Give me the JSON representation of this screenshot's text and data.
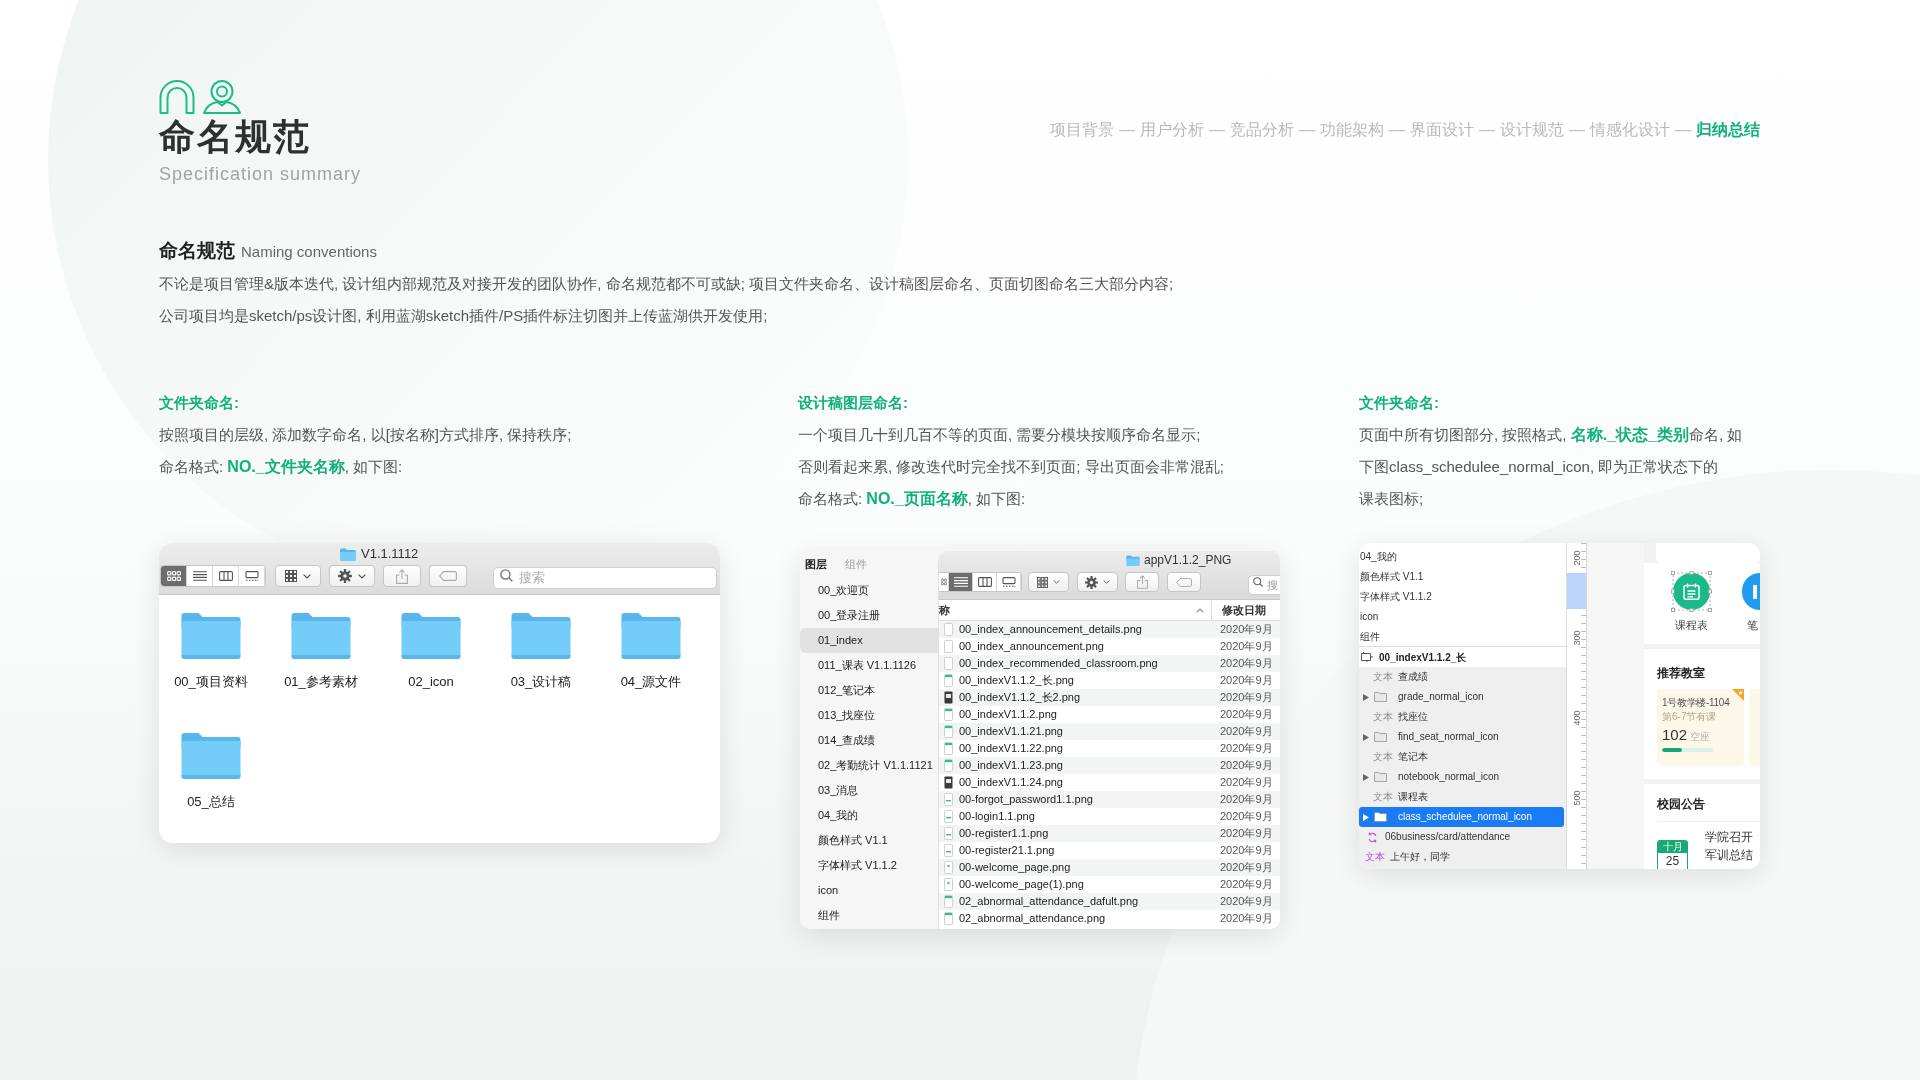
{
  "header": {
    "title": "命名规范",
    "subtitle": "Specification summary"
  },
  "nav": {
    "separator": "—",
    "items": [
      {
        "label": "项目背景",
        "selected": false
      },
      {
        "label": "用户分析",
        "selected": false
      },
      {
        "label": "竞品分析",
        "selected": false
      },
      {
        "label": "功能架构",
        "selected": false
      },
      {
        "label": "界面设计",
        "selected": false
      },
      {
        "label": "设计规范",
        "selected": false
      },
      {
        "label": "情感化设计",
        "selected": false
      },
      {
        "label": "归纳总结",
        "selected": true
      }
    ]
  },
  "intro": {
    "title": "命名规范",
    "title_en": "Naming conventions",
    "lines": [
      "不论是项目管理&版本迭代, 设计组内部规范及对接开发的团队协作, 命名规范都不可或缺; 项目文件夹命名、设计稿图层命名、页面切图命名三大部分内容;",
      "公司项目均是sketch/ps设计图, 利用蓝湖sketch插件/PS插件标注切图并上传蓝湖供开发使用;"
    ]
  },
  "columns": [
    {
      "heading": "文件夹命名:",
      "lines": [
        "按照项目的层级, 添加数字命名, 以[按名称]方式排序, 保持秩序;",
        "命名格式: **NO._文件夹名称**, 如下图:"
      ],
      "figure": {
        "kind": "folder_window",
        "title": "V1.1.1112",
        "view_modes": [
          {
            "kind": "grid",
            "selected": true
          },
          {
            "kind": "list",
            "selected": false
          },
          {
            "kind": "columns",
            "selected": false
          },
          {
            "kind": "gallery",
            "selected": false
          }
        ],
        "search": {
          "placeholder": "搜索"
        },
        "folders": [
          "00_项目资料",
          "01_参考素材",
          "02_icon",
          "03_设计稿",
          "04_源文件",
          "05_总结"
        ]
      }
    },
    {
      "heading": "设计稿图层命名:",
      "lines": [
        "一个项目几十到几百不等的页面, 需要分模块按顺序命名显示;",
        "否则看起来累, 修改迭代时完全找不到页面; 导出页面会非常混乱;",
        "命名格式: **NO._页面名称**, 如下图:"
      ],
      "figure": {
        "kind": "sketch_export",
        "tabs": [
          {
            "label": "图层",
            "selected": true
          },
          {
            "label": "组件",
            "selected": false
          }
        ],
        "pages": [
          {
            "label": "00_欢迎页",
            "selected": false
          },
          {
            "label": "00_登录注册",
            "selected": false
          },
          {
            "label": "01_index",
            "selected": true
          },
          {
            "label": "011_课表 V1.1.1126",
            "selected": false
          },
          {
            "label": "012_笔记本",
            "selected": false
          },
          {
            "label": "013_找座位",
            "selected": false
          },
          {
            "label": "014_查成绩",
            "selected": false
          },
          {
            "label": "02_考勤统计 V1.1.1121",
            "selected": false
          },
          {
            "label": "03_消息",
            "selected": false
          },
          {
            "label": "04_我的",
            "selected": false
          },
          {
            "label": "颜色样式 V1.1",
            "selected": false
          },
          {
            "label": "字体样式 V1.1.2",
            "selected": false
          },
          {
            "label": "icon",
            "selected": false
          },
          {
            "label": "组件",
            "selected": false
          }
        ],
        "window": {
          "title": "appV1.1.2_PNG",
          "view_modes": [
            {
              "kind": "grid",
              "selected": false
            },
            {
              "kind": "list",
              "selected": true
            },
            {
              "kind": "columns",
              "selected": false
            },
            {
              "kind": "gallery",
              "selected": false
            }
          ],
          "search": {
            "placeholder": "搜"
          },
          "columns": [
            "称",
            "修改日期"
          ],
          "files": [
            {
              "name": "00_index_announcement_details.png",
              "date": "2020年9月",
              "kind": "plain"
            },
            {
              "name": "00_index_announcement.png",
              "date": "2020年9月",
              "kind": "plain"
            },
            {
              "name": "00_index_recommended_classroom.png",
              "date": "2020年9月",
              "kind": "plain"
            },
            {
              "name": "00_indexV1.1.2_长.png",
              "date": "2020年9月",
              "kind": "green"
            },
            {
              "name": "00_indexV1.1.2_长2.png",
              "date": "2020年9月",
              "kind": "dark"
            },
            {
              "name": "00_indexV1.1.2.png",
              "date": "2020年9月",
              "kind": "green"
            },
            {
              "name": "00_indexV1.1.21.png",
              "date": "2020年9月",
              "kind": "green"
            },
            {
              "name": "00_indexV1.1.22.png",
              "date": "2020年9月",
              "kind": "green"
            },
            {
              "name": "00_indexV1.1.23.png",
              "date": "2020年9月",
              "kind": "green"
            },
            {
              "name": "00_indexV1.1.24.png",
              "date": "2020年9月",
              "kind": "dark"
            },
            {
              "name": "00-forgot_password1.1.png",
              "date": "2020年9月",
              "kind": "form"
            },
            {
              "name": "00-login1.1.png",
              "date": "2020年9月",
              "kind": "form"
            },
            {
              "name": "00-register1.1.png",
              "date": "2020年9月",
              "kind": "form"
            },
            {
              "name": "00-register21.1.png",
              "date": "2020年9月",
              "kind": "form"
            },
            {
              "name": "00-welcome_page.png",
              "date": "2020年9月",
              "kind": "welcome"
            },
            {
              "name": "00-welcome_page(1).png",
              "date": "2020年9月",
              "kind": "welcome"
            },
            {
              "name": "02_abnormal_attendance_dafult.png",
              "date": "2020年9月",
              "kind": "green"
            },
            {
              "name": "02_abnormal_attendance.png",
              "date": "2020年9月",
              "kind": "green"
            }
          ]
        }
      }
    },
    {
      "heading": "文件夹命名:",
      "lines": [
        "页面中所有切图部分, 按照格式, **名称._状态_类别**命名, 如",
        "下图class_schedulee_normal_icon, 即为正常状态下的",
        "课表图标;"
      ],
      "figure": {
        "kind": "sketch_layers",
        "pages": [
          {
            "label": "04_我的",
            "selected": false
          },
          {
            "label": "颜色样式 V1.1",
            "selected": false
          },
          {
            "label": "字体样式 V1.1.2",
            "selected": false
          },
          {
            "label": "icon",
            "selected": false
          },
          {
            "label": "组件",
            "selected": false
          }
        ],
        "artboard": {
          "label": "00_indexV1.1.2_长",
          "children": [
            {
              "kind": "text",
              "tag": "文本",
              "label": "查成绩",
              "selected": false
            },
            {
              "kind": "group",
              "label": "grade_normal_icon",
              "expanded": false,
              "selected": false
            },
            {
              "kind": "text",
              "tag": "文本",
              "label": "找座位",
              "selected": false
            },
            {
              "kind": "group",
              "label": "find_seat_normal_icon",
              "expanded": false,
              "selected": false
            },
            {
              "kind": "text",
              "tag": "文本",
              "label": "笔记本",
              "selected": false
            },
            {
              "kind": "group",
              "label": "notebook_normal_icon",
              "expanded": false,
              "selected": false
            },
            {
              "kind": "text",
              "tag": "文本",
              "label": "课程表",
              "selected": false
            },
            {
              "kind": "group",
              "label": "class_schedulee_normal_icon",
              "expanded": false,
              "selected": true
            },
            {
              "kind": "symbol",
              "label": "06business/card/attendance",
              "selected": false
            },
            {
              "kind": "symbol_text",
              "tag": "文本",
              "label": "上午好，同学",
              "selected": false
            }
          ]
        },
        "ruler": [
          "200",
          "300",
          "400",
          "500"
        ],
        "app": {
          "shortcuts": [
            {
              "label": "课程表",
              "color": "#19b98a",
              "selected": true
            },
            {
              "label": "笔",
              "color": "#1f9cf0",
              "selected": false
            }
          ],
          "recommend": {
            "title": "推荐教室",
            "rooms": [
              {
                "name": "1号教学楼-1104",
                "schedule": "第6-7节有课",
                "count": "102",
                "unit": "空座",
                "level": 0.4,
                "starred": true
              }
            ]
          },
          "notice": {
            "title": "校园公告",
            "month": "十月",
            "day": "25",
            "headline_lines": [
              "学院召开",
              "军训总结"
            ]
          }
        }
      }
    }
  ]
}
